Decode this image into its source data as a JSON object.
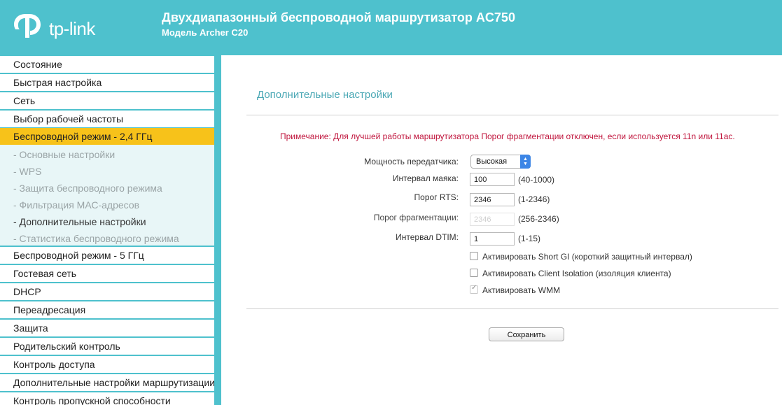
{
  "header": {
    "logo_text": "tp-link",
    "title": "Двухдиапазонный беспроводной маршрутизатор AC750",
    "subtitle": "Модель Archer C20"
  },
  "sidebar": {
    "items_top": [
      {
        "label": "Состояние"
      },
      {
        "label": "Быстрая настройка"
      },
      {
        "label": "Сеть"
      },
      {
        "label": "Выбор рабочей частоты"
      }
    ],
    "active": {
      "label": "Беспроводной режим - 2,4 ГГц"
    },
    "sub_items": [
      {
        "label": "- Основные настройки"
      },
      {
        "label": "- WPS"
      },
      {
        "label": "- Защита беспроводного режима"
      },
      {
        "label": "- Фильтрация МАС-адресов"
      },
      {
        "label": "- Дополнительные настройки"
      },
      {
        "label": "- Статистика беспроводного режима"
      }
    ],
    "items_bottom": [
      {
        "label": "Беспроводной режим - 5 ГГц"
      },
      {
        "label": "Гостевая сеть"
      },
      {
        "label": "DHCP"
      },
      {
        "label": "Переадресация"
      },
      {
        "label": "Защита"
      },
      {
        "label": "Родительский контроль"
      },
      {
        "label": "Контроль доступа"
      },
      {
        "label": "Дополнительные настройки маршрутизации"
      },
      {
        "label": "Контроль пропускной способности"
      }
    ]
  },
  "main": {
    "section_title": "Дополнительные настройки",
    "note": "Примечание: Для лучшей работы маршрутизатора Порог фрагментации отключен, если используется 11n или 11ac.",
    "tx_power": {
      "label": "Мощность передатчика:",
      "value": "Высокая"
    },
    "beacon": {
      "label": "Интервал маяка:",
      "value": "100",
      "range": "(40-1000)"
    },
    "rts": {
      "label": "Порог RTS:",
      "value": "2346",
      "range": "(1-2346)"
    },
    "frag": {
      "label": "Порог фрагментации:",
      "value": "2346",
      "range": "(256-2346)"
    },
    "dtim": {
      "label": "Интервал DTIM:",
      "value": "1",
      "range": "(1-15)"
    },
    "short_gi": {
      "label": "Активировать Short GI (короткий защитный интервал)",
      "checked": false
    },
    "client_isolation": {
      "label": "Активировать Client Isolation (изоляция клиента)",
      "checked": false
    },
    "wmm": {
      "label": "Активировать WMM",
      "checked": true,
      "disabled": true
    },
    "save_label": "Сохранить"
  },
  "colors": {
    "brand": "#4ec1cd",
    "active": "#f7c21a",
    "note": "#c0143c",
    "section_title": "#4ba8b5"
  }
}
